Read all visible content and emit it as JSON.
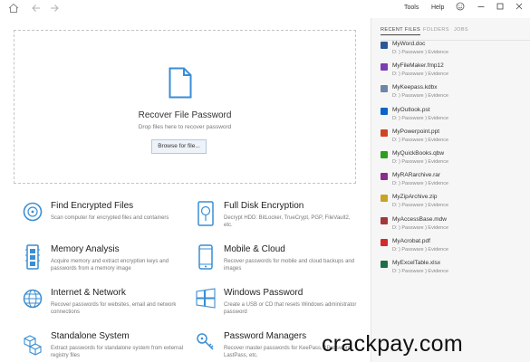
{
  "titlebar": {
    "menu": {
      "tools": "Tools",
      "help": "Help"
    },
    "icons": {
      "home": "home-icon",
      "back": "arrow-left-icon",
      "forward": "arrow-right-icon",
      "smiley": "smiley-icon",
      "minimize": "minimize-icon",
      "maximize": "maximize-icon",
      "close": "close-icon"
    }
  },
  "dropzone": {
    "title": "Recover File Password",
    "subtitle": "Drop files here to recover password",
    "browse_label": "Browse for file..."
  },
  "features": [
    {
      "title": "Find Encrypted Files",
      "desc": "Scan computer for encrypted files and containers",
      "icon": "disc-scan-icon"
    },
    {
      "title": "Full Disk Encryption",
      "desc": "Decrypt HDD: BitLocker, TrueCrypt, PGP, FileVault2, etc.",
      "icon": "disk-icon"
    },
    {
      "title": "Memory Analysis",
      "desc": "Acquire memory and extract encryption keys and passwords from a memory image",
      "icon": "memory-icon"
    },
    {
      "title": "Mobile & Cloud",
      "desc": "Recover passwords for mobile and cloud backups and images",
      "icon": "mobile-icon"
    },
    {
      "title": "Internet & Network",
      "desc": "Recover passwords for websites, email and network connections",
      "icon": "globe-icon"
    },
    {
      "title": "Windows Password",
      "desc": "Create a USB or CD that resets Windows administrator password",
      "icon": "windows-icon"
    },
    {
      "title": "Standalone System",
      "desc": "Extract passwords for standalone system from external registry files",
      "icon": "cubes-icon"
    },
    {
      "title": "Password Managers",
      "desc": "Recover master passwords for KeePass, 1Password, LastPass, etc.",
      "icon": "key-icon"
    }
  ],
  "recent": {
    "tabs": [
      "RECENT FILES",
      "FOLDERS",
      "JOBS"
    ],
    "files": [
      {
        "name": "MyWord.doc",
        "path": "D: ) Passware ) Evidence",
        "color": "#2b5797"
      },
      {
        "name": "MyFileMaker.fmp12",
        "path": "D: ) Passware ) Evidence",
        "color": "#7a3fb0"
      },
      {
        "name": "MyKeepass.kdbx",
        "path": "D: ) Passware ) Evidence",
        "color": "#6e86a8"
      },
      {
        "name": "MyOutlook.pst",
        "path": "D: ) Passware ) Evidence",
        "color": "#0a64c8"
      },
      {
        "name": "MyPowerpoint.ppt",
        "path": "D: ) Passware ) Evidence",
        "color": "#d04423"
      },
      {
        "name": "MyQuickBooks.qbw",
        "path": "D: ) Passware ) Evidence",
        "color": "#2ca01c"
      },
      {
        "name": "MyRARarchive.rar",
        "path": "D: ) Passware ) Evidence",
        "color": "#8a2c8a"
      },
      {
        "name": "MyZipArchive.zip",
        "path": "D: ) Passware ) Evidence",
        "color": "#c9a227"
      },
      {
        "name": "MyAccessBase.mdw",
        "path": "D: ) Passware ) Evidence",
        "color": "#a4373a"
      },
      {
        "name": "MyAcrobat.pdf",
        "path": "D: ) Passware ) Evidence",
        "color": "#d12b2b"
      },
      {
        "name": "MyExcelTable.xlsx",
        "path": "D: ) Passware ) Evidence",
        "color": "#1d7044"
      }
    ]
  },
  "watermark": "crackpay.com",
  "colors": {
    "accent": "#3a8ed4",
    "panel": "#f6f6f6"
  }
}
